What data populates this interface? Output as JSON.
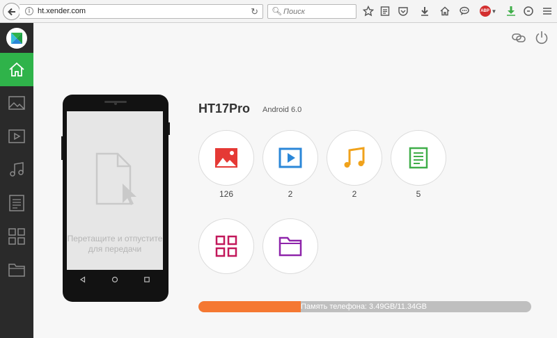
{
  "browser": {
    "url": "ht.xender.com",
    "search_placeholder": "Поиск",
    "adblock_badge": "ABP",
    "icons": [
      "back-icon",
      "info-icon",
      "reload-icon",
      "search-icon",
      "star-icon",
      "reader-icon",
      "pocket-icon",
      "download-icon",
      "home-icon",
      "chat-icon",
      "adblock-icon",
      "download-helper-icon",
      "extension-icon"
    ]
  },
  "sidebar": {
    "items": [
      {
        "name": "home",
        "icon": "home-icon",
        "active": true
      },
      {
        "name": "images",
        "icon": "image-icon"
      },
      {
        "name": "videos",
        "icon": "video-icon"
      },
      {
        "name": "music",
        "icon": "music-icon"
      },
      {
        "name": "documents",
        "icon": "document-icon"
      },
      {
        "name": "apps",
        "icon": "apps-icon"
      },
      {
        "name": "files",
        "icon": "folder-icon"
      }
    ]
  },
  "phone": {
    "drop_hint": "Перетащите и отпустите для передачи"
  },
  "device": {
    "name": "HT17Pro",
    "os": "Android 6.0"
  },
  "categories": [
    {
      "name": "images",
      "count": "126",
      "color": "#e53935"
    },
    {
      "name": "videos",
      "count": "2",
      "color": "#2b87d8"
    },
    {
      "name": "music",
      "count": "2",
      "color": "#f0a21b"
    },
    {
      "name": "documents",
      "count": "5",
      "color": "#3fae49"
    },
    {
      "name": "apps",
      "count": "",
      "color": "#c2185b"
    },
    {
      "name": "files",
      "count": "",
      "color": "#8e24aa"
    }
  ],
  "storage": {
    "label": "Память телефона: 3.49GB/11.34GB",
    "used_fraction": 0.308,
    "fill_color": "#f57832"
  },
  "colors": {
    "accent": "#2fb34a",
    "sidebar_bg": "#2a2a2a"
  }
}
